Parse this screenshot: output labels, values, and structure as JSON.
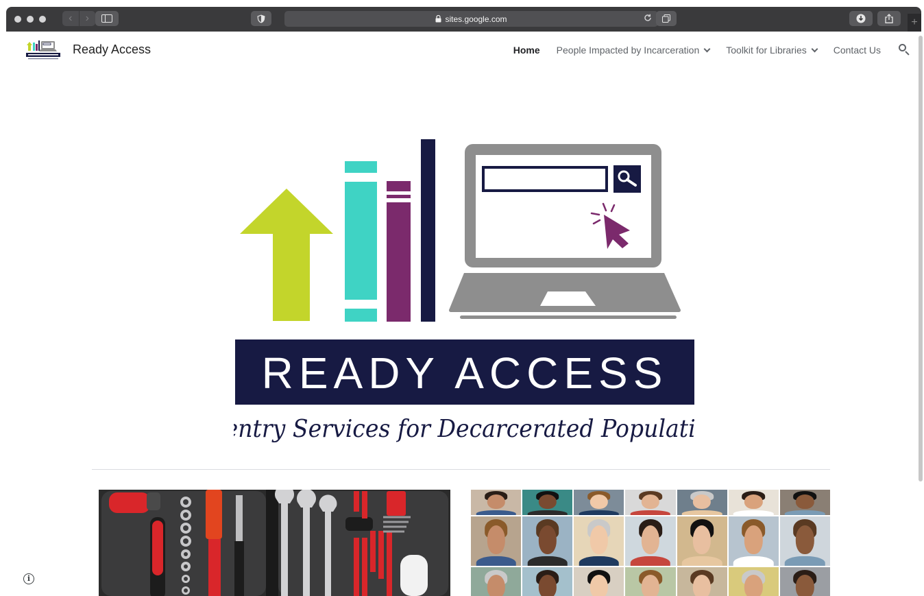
{
  "browser": {
    "url": "sites.google.com",
    "back": "‹",
    "forward": "›",
    "new_tab": "+"
  },
  "site": {
    "title": "Ready Access",
    "nav": [
      {
        "label": "Home",
        "active": true,
        "has_dropdown": false
      },
      {
        "label": "People Impacted by Incarceration",
        "active": false,
        "has_dropdown": true
      },
      {
        "label": "Toolkit for Libraries",
        "active": false,
        "has_dropdown": true
      },
      {
        "label": "Contact Us",
        "active": false,
        "has_dropdown": false
      }
    ]
  },
  "hero": {
    "banner": "READY ACCESS",
    "tagline": "Reentry Services for Decarcerated Populations"
  },
  "colors": {
    "lime": "#c3d52b",
    "teal": "#3fd3c4",
    "purple": "#7b2a6c",
    "navy": "#171a43",
    "gray": "#8e8e8e"
  },
  "footer": {
    "info_symbol": "i"
  }
}
